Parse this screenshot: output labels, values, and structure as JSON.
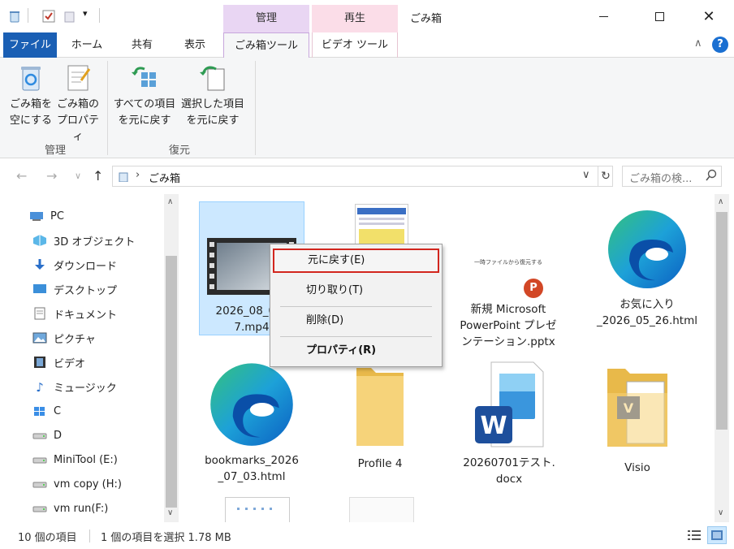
{
  "window": {
    "title": "ごみ箱",
    "context_tab_headers": [
      "管理",
      "再生"
    ]
  },
  "ribbon_tabs": [
    "ファイル",
    "ホーム",
    "共有",
    "表示",
    "ごみ箱ツール",
    "ビデオ ツール"
  ],
  "ribbon": {
    "groups": [
      {
        "label": "管理",
        "buttons": [
          {
            "line1": "ごみ箱を",
            "line2": "空にする",
            "icon": "recycle-bin-icon"
          },
          {
            "line1": "ごみ箱の",
            "line2": "プロパティ",
            "icon": "properties-icon"
          }
        ]
      },
      {
        "label": "復元",
        "buttons": [
          {
            "line1": "すべての項目",
            "line2": "を元に戻す",
            "icon": "restore-all-icon"
          },
          {
            "line1": "選択した項目",
            "line2": "を元に戻す",
            "icon": "restore-selected-icon"
          }
        ]
      }
    ]
  },
  "address": {
    "path": "ごみ箱",
    "search_placeholder": "ごみ箱の検..."
  },
  "nav_items": [
    {
      "label": "PC",
      "icon": "pc-icon"
    },
    {
      "label": "3D オブジェクト",
      "icon": "3d-objects-icon"
    },
    {
      "label": "ダウンロード",
      "icon": "download-icon"
    },
    {
      "label": "デスクトップ",
      "icon": "desktop-icon"
    },
    {
      "label": "ドキュメント",
      "icon": "documents-icon"
    },
    {
      "label": "ピクチャ",
      "icon": "pictures-icon"
    },
    {
      "label": "ビデオ",
      "icon": "video-icon"
    },
    {
      "label": "ミュージック",
      "icon": "music-icon"
    },
    {
      "label": "C",
      "icon": "drive-icon"
    },
    {
      "label": "D",
      "icon": "drive-icon"
    },
    {
      "label": "MiniTool (E:)",
      "icon": "drive-icon"
    },
    {
      "label": "vm copy (H:)",
      "icon": "drive-icon"
    },
    {
      "label": "vm run(F:)",
      "icon": "drive-icon"
    }
  ],
  "files": [
    {
      "line1": "2026_08_03_",
      "line2": "7.mp4",
      "type": "video"
    },
    {
      "line1": "",
      "line2": "",
      "type": "document-thumb"
    },
    {
      "line1": "新規 Microsoft",
      "line2": "PowerPoint プレゼ",
      "line3": "ンテーション.pptx",
      "type": "pptx",
      "thumb_text": "一時ファイルから復元する"
    },
    {
      "line1": "お気に入り",
      "line2": "_2026_05_26.html",
      "type": "edge"
    },
    {
      "line1": "bookmarks_2026",
      "line2": "_07_03.html",
      "type": "edge"
    },
    {
      "line1": "Profile 4",
      "line2": "",
      "type": "folder"
    },
    {
      "line1": "20260701テスト.",
      "line2": "docx",
      "type": "word"
    },
    {
      "line1": "Visio",
      "line2": "",
      "type": "folder-visio"
    }
  ],
  "context_menu": {
    "items": [
      "元に戻す(E)",
      "切り取り(T)",
      "削除(D)",
      "プロパティ(R)"
    ]
  },
  "status": {
    "item_count": "10 個の項目",
    "selection": "1 個の項目を選択  1.78 MB"
  },
  "colors": {
    "file_tab": "#1a5fb4",
    "manage_header": "#e9d6f3",
    "play_header": "#fbdde8",
    "selection": "#cce8ff",
    "highlight_border": "#d2261e",
    "edge_blue": "#0c6fce",
    "edge_green": "#39c47f"
  }
}
